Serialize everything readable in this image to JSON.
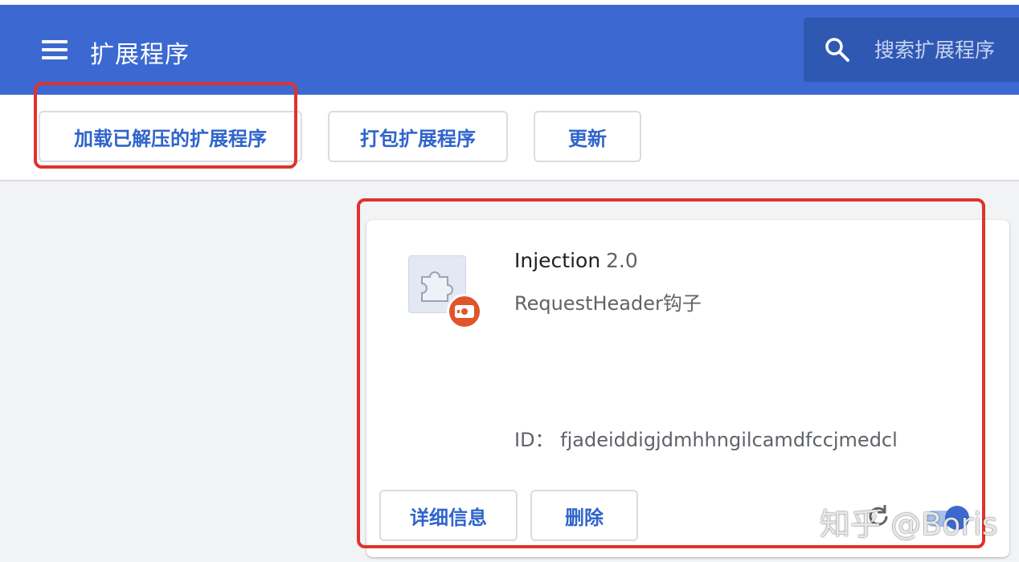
{
  "header": {
    "title": "扩展程序",
    "menu_icon": "hamburger-menu-icon",
    "search": {
      "placeholder": "搜索扩展程序",
      "icon": "search-icon"
    }
  },
  "toolbar": {
    "load_unpacked_label": "加载已解压的扩展程序",
    "pack_label": "打包扩展程序",
    "update_label": "更新"
  },
  "extension": {
    "name": "Injection",
    "version": "2.0",
    "description": "RequestHeader钩子",
    "id_text": "ID： fjadeiddigjdmhhngilcamdfccjmedcl",
    "icon": "puzzle-piece-icon",
    "badge_icon": "developer-mode-badge-icon",
    "details_label": "详细信息",
    "remove_label": "删除",
    "enabled": true
  },
  "watermark": "知乎 @Boris",
  "colors": {
    "header_bg": "#3c69d1",
    "accent": "#2f64cb",
    "highlight": "#e0322d",
    "badge": "#e0552c"
  }
}
